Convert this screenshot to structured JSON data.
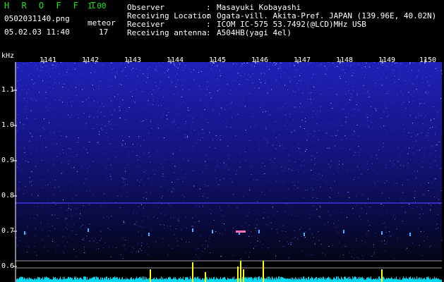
{
  "header": {
    "app_title": "H R O F F T",
    "app_version": "1.00",
    "file_name": "0502031140.png",
    "date_time": "05.02.03 11:40",
    "meteor_label": "meteor",
    "meteor_count": "17"
  },
  "info": [
    {
      "key": "Observer",
      "value": "Masayuki Kobayashi"
    },
    {
      "key": "Receiving Location",
      "value": "Ogata-vill. Akita-Pref. JAPAN (139.96E, 40.02N)"
    },
    {
      "key": "Receiver",
      "value": "ICOM IC-575 53.7492(@LCD)MHz USB"
    },
    {
      "key": "Receiving antenna",
      "value": "A504HB(yagi 4el)"
    }
  ],
  "info_colon": ":",
  "plot": {
    "y_unit": "kHz",
    "y_ticks": [
      "1.1",
      "1.0",
      "0.9",
      "0.8",
      "0.7",
      "0.6"
    ],
    "x_ticks": [
      "1141",
      "1142",
      "1143",
      "1144",
      "1145",
      "1146",
      "1147",
      "1148",
      "1149",
      "1150"
    ]
  },
  "colors": {
    "background": "#000000",
    "spectrogram": "#1a1aa0",
    "noise_dots": "#8080ff",
    "trace": "#00e5ff",
    "meteor_peak": "#ffff00",
    "title_green": "#19e619"
  }
}
